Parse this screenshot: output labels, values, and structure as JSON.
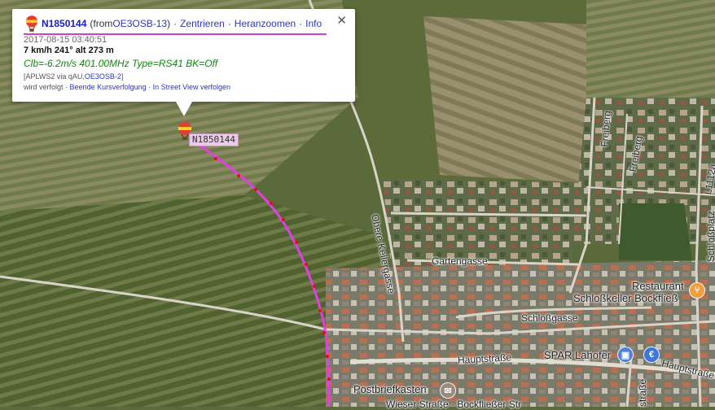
{
  "map": {
    "streets": [
      {
        "id": "obere-kellergasse",
        "label": "Obere Kellergasse"
      },
      {
        "id": "gartengasse",
        "label": "Gartengasse"
      },
      {
        "id": "schlossgasse",
        "label": "Schloßgasse"
      },
      {
        "id": "hauptstrasse-1",
        "label": "Hauptstraße"
      },
      {
        "id": "hauptstrasse-2",
        "label": "Hauptstraße"
      },
      {
        "id": "freiberg-1",
        "label": "Freiberg"
      },
      {
        "id": "freiberg-2",
        "label": "Freiberg"
      },
      {
        "id": "l1112a",
        "label": "L1112a"
      },
      {
        "id": "schlossplatz",
        "label": "Schloßplatz"
      },
      {
        "id": "strasse-v",
        "label": "straße"
      },
      {
        "id": "bottom-street",
        "label": "Wieser Straße · Bockfließer Str"
      }
    ],
    "pois": [
      {
        "id": "restaurant",
        "label_line1": "Restaurant",
        "label_line2": "Schloßkeller Bockfließ",
        "icon": "fork-knife-icon",
        "color": "#f29e3c"
      },
      {
        "id": "spar",
        "label": "SPAR Lahofer",
        "icon": "shopping-bag-icon",
        "color": "#4f83d9"
      },
      {
        "id": "euro",
        "label": "€",
        "icon": "euro-icon",
        "color": "#3d78d8"
      },
      {
        "id": "postbox",
        "label": "Postbriefkasten",
        "icon": "postbox-icon",
        "color": "#9a8a80"
      }
    ],
    "track_color": "#e040e0",
    "track_point_color": "#e01010"
  },
  "marker": {
    "callsign": "N1850144",
    "icon": "balloon-icon"
  },
  "popup": {
    "callsign": "N1850144",
    "from_prefix": "(from",
    "from_station": "OE3OSB-13",
    "from_suffix": ")",
    "sep": "·",
    "link_center": "Zentrieren",
    "link_zoom": "Heranzoomen",
    "link_info": "Info",
    "timestamp": "2017-08-15 03:40:51",
    "speed_line": "7 km/h 241° alt 273 m",
    "comment": "Clb=-6.2m/s 401.00MHz Type=RS41 BK=Off",
    "path_prefix": "[APLWS2 via qAU,",
    "path_station": "OE3OSB-2",
    "path_suffix": "]",
    "tracked_text": "wird verfolgt",
    "link_stop_tracking": "Beende Kursverfolgung",
    "link_street_view": "In Street View verfolgen",
    "close_symbol": "✕"
  }
}
